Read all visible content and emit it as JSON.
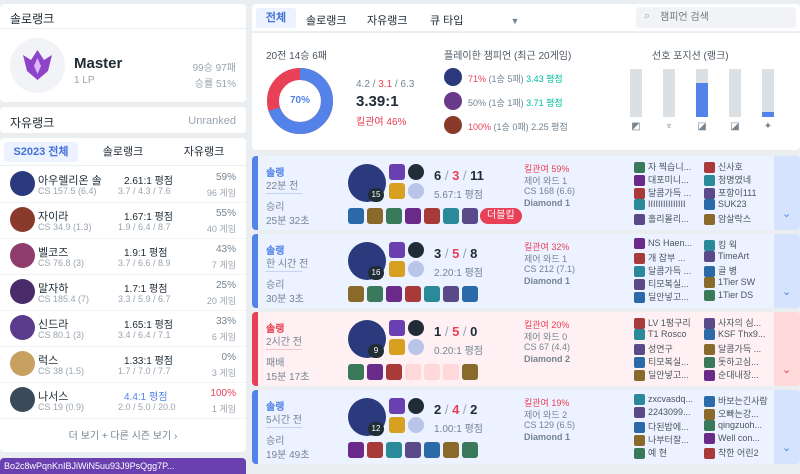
{
  "solo": {
    "title": "솔로랭크",
    "tier": "Master",
    "lp": "1 LP",
    "record": "99승 97패",
    "winrate": "승률 51%"
  },
  "flex": {
    "title": "자유랭크",
    "status": "Unranked"
  },
  "season": {
    "tabs": [
      "S2023 전체",
      "솔로랭크",
      "자유랭크"
    ],
    "more": "더 보기 + 다른 시즌 보기",
    "champs": [
      {
        "name": "아우렐리온 솔",
        "cs": "CS 157.5 (6.4)",
        "kda": "2.61:1 평점",
        "kdadetail": "3.7 / 4.3 / 7.6",
        "wr": "59%",
        "games": "96 게임",
        "color": "#2a3a7c",
        "wrred": false,
        "kdacolor": "#202d37"
      },
      {
        "name": "자이라",
        "cs": "CS 34.9 (1.3)",
        "kda": "1.67:1 평점",
        "kdadetail": "1.9 / 6.4 / 8.7",
        "wr": "55%",
        "games": "40 게임",
        "color": "#8a3a2a",
        "wrred": false,
        "kdacolor": "#202d37"
      },
      {
        "name": "벨코즈",
        "cs": "CS 76.8 (3)",
        "kda": "1.9:1 평점",
        "kdadetail": "3.7 / 6.6 / 8.9",
        "wr": "43%",
        "games": "7 게임",
        "color": "#8e3b6e",
        "wrred": false,
        "kdacolor": "#202d37"
      },
      {
        "name": "말자하",
        "cs": "CS 185.4 (7)",
        "kda": "1.7:1 평점",
        "kdadetail": "3.3 / 5.9 / 6.7",
        "wr": "25%",
        "games": "20 게임",
        "color": "#4a2b6a",
        "wrred": false,
        "kdacolor": "#202d37"
      },
      {
        "name": "신드라",
        "cs": "CS 80.1 (3)",
        "kda": "1.65:1 평점",
        "kdadetail": "3.4 / 6.4 / 7.1",
        "wr": "33%",
        "games": "6 게임",
        "color": "#5a3a8a",
        "wrred": false,
        "kdacolor": "#202d37"
      },
      {
        "name": "럭스",
        "cs": "CS 38 (1.5)",
        "kda": "1.33:1 평점",
        "kdadetail": "1.7 / 7.0 / 7.7",
        "wr": "0%",
        "games": "3 게임",
        "color": "#c8a060",
        "wrred": false,
        "kdacolor": "#202d37"
      },
      {
        "name": "나서스",
        "cs": "CS 19 (0.9)",
        "kda": "4.4:1 평점",
        "kdadetail": "2.0 / 5.0 / 20.0",
        "wr": "100%",
        "games": "1 게임",
        "color": "#3a4a5a",
        "wrred": true,
        "kdacolor": "#5383e8"
      }
    ]
  },
  "bottom_text": "Bo2c8wPqnKnIBJiWiN5uu93J9PsQgg7P...",
  "top": {
    "tabs": [
      "전체",
      "솔로랭크",
      "자유랭크",
      "큐 타입"
    ],
    "search": "챔피언 검색"
  },
  "summary": {
    "record": "20전 14승 6패",
    "winrate": "70%",
    "kda_parts": [
      "4.2",
      "3.1",
      "6.3"
    ],
    "kda": "3.39:1",
    "kp": "킬관여 46%",
    "played_title": "플레이한 챔피언 (최근 20게임)",
    "played": [
      {
        "wr": "71%",
        "detail": "(1승 5패)",
        "score": "3.43 평점",
        "color": "#2a3a7c",
        "wrred": true,
        "scorecolor": "#00bba3"
      },
      {
        "wr": "50%",
        "detail": "(1승 1패)",
        "score": "3.71 평점",
        "color": "#6a3a8a",
        "wrred": false,
        "scorecolor": "#00bba3"
      },
      {
        "wr": "100%",
        "detail": "(1승 0패)",
        "score": "2.25 평점",
        "color": "#8a3a2a",
        "wrred": true,
        "scorecolor": "#758592"
      }
    ],
    "pos_title": "선호 포지션 (랭크)",
    "positions": [
      0,
      0,
      0.7,
      0,
      0.1
    ]
  },
  "matches": [
    {
      "type": "솔랭",
      "ago": "22분 전",
      "result": "승리",
      "duration": "25분 32초",
      "win": true,
      "level": "15",
      "k": "6",
      "d": "3",
      "a": "11",
      "kda": "5.67:1 평점",
      "kp": "킬관여 59%",
      "ward": "제어 와드 1",
      "cs": "CS 168 (6.6)",
      "tier": "Diamond 1",
      "badge": "더블킬",
      "blue": [
        "자 찍습니...",
        "대포미니...",
        "달콤가득 ...",
        "IIIIIIIIIIIIIII",
        "홀리몰리..."
      ],
      "red": [
        "신사호",
        "청명였네",
        "포항이111",
        "SUK23",
        "암살락스"
      ]
    },
    {
      "type": "솔랭",
      "ago": "한 시간 전",
      "result": "승리",
      "duration": "30분 3초",
      "win": true,
      "level": "16",
      "k": "3",
      "d": "5",
      "a": "8",
      "kda": "2.20:1 평점",
      "kp": "킬관여 32%",
      "ward": "제어 와드 1",
      "cs": "CS 212 (7.1)",
      "tier": "Diamond 1",
      "badge": "",
      "blue": [
        "NS Haen...",
        "개 잡부 ...",
        "달콤가득 ...",
        "티모복실...",
        "딜안넣고..."
      ],
      "red": [
        "킹 웍",
        "TimeArt",
        "골 병",
        "1Tier SW",
        "1Tier DS"
      ]
    },
    {
      "type": "솔랭",
      "ago": "2시간 전",
      "result": "패배",
      "duration": "15분 17초",
      "win": false,
      "level": "9",
      "k": "1",
      "d": "5",
      "a": "0",
      "kda": "0.20:1 평점",
      "kp": "킬관여 20%",
      "ward": "제어 와드 0",
      "cs": "CS 67 (4.4)",
      "tier": "Diamond 2",
      "badge": "",
      "blue": [
        "LV 1펑구리",
        "T1 Rosco",
        "성연구",
        "티모복실...",
        "딜안넣고..."
      ],
      "red": [
        "사자의 심...",
        "KSF Thx9...",
        "달콤가득 ...",
        "돗하고심...",
        "순대내장..."
      ]
    },
    {
      "type": "솔랭",
      "ago": "5시간 전",
      "result": "승리",
      "duration": "19분 49초",
      "win": true,
      "level": "12",
      "k": "2",
      "d": "4",
      "a": "2",
      "kda": "1.00:1 평점",
      "kp": "킬관여 19%",
      "ward": "제어 와드 2",
      "cs": "CS 129 (6.5)",
      "tier": "Diamond 1",
      "badge": "",
      "blue": [
        "zxcvasdq...",
        "2243099...",
        "다된밥에...",
        "나부터잘...",
        "예 현"
      ],
      "red": [
        "바보는긴사람",
        "오빠는강...",
        "qingzuoh...",
        "Well con...",
        "착한 어린2"
      ]
    }
  ]
}
